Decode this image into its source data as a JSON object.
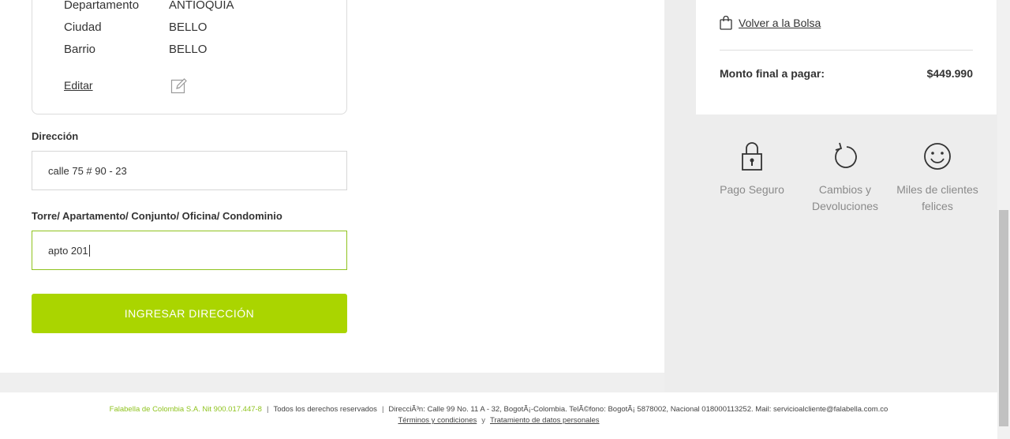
{
  "address_card": {
    "rows": [
      {
        "label": "Departamento",
        "value": "ANTIOQUIA"
      },
      {
        "label": "Ciudad",
        "value": "BELLO"
      },
      {
        "label": "Barrio",
        "value": "BELLO"
      }
    ],
    "edit_label": "Editar",
    "edit_icon": "edit-pencil-icon"
  },
  "form": {
    "address_label": "Dirección",
    "address_value": "calle 75 # 90 - 23",
    "unit_label": "Torre/ Apartamento/ Conjunto/ Oficina/ Condominio",
    "unit_value": "apto 201",
    "submit_label": "INGRESAR DIRECCIÓN",
    "accent_color": "#aad500"
  },
  "summary": {
    "back_label": "Volver a la Bolsa",
    "back_icon": "shopping-bag-icon",
    "total_label": "Monto final a pagar:",
    "total_value": "$449.990"
  },
  "badges": [
    {
      "icon": "padlock-icon",
      "label": "Pago Seguro"
    },
    {
      "icon": "return-arrow-icon",
      "label": "Cambios y Devoluciones"
    },
    {
      "icon": "smiley-face-icon",
      "label": "Miles de clientes felices"
    }
  ],
  "footer": {
    "company": "Falabella de Colombia S.A. Nit 900.017.447-8",
    "rights": "Todos los derechos reservados",
    "contact": "DirecciÃ³n: Calle 99 No. 11 A - 32, BogotÃ¡-Colombia. TelÃ©fono: BogotÃ¡ 5878002, Nacional 018000113252. Mail: servicioalcliente@falabella.com.co",
    "terms": "Términos y condiciones",
    "and": "y",
    "privacy": "Tratamiento de datos personales"
  }
}
